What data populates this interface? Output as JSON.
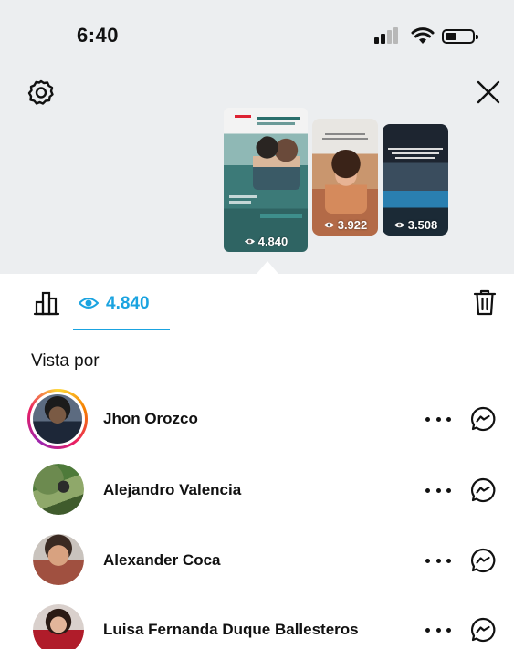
{
  "status_bar": {
    "time": "6:40"
  },
  "stories": [
    {
      "views": "4.840",
      "selected": true
    },
    {
      "views": "3.922",
      "selected": false
    },
    {
      "views": "3.508",
      "selected": false
    }
  ],
  "toolbar": {
    "views_count": "4.840",
    "accent_color": "#1aa3e0"
  },
  "section": {
    "title": "Vista por"
  },
  "viewers": [
    {
      "name": "Jhon Orozco",
      "has_story_ring": true
    },
    {
      "name": "Alejandro Valencia",
      "has_story_ring": false
    },
    {
      "name": "Alexander Coca",
      "has_story_ring": false
    },
    {
      "name": "Luisa Fernanda Duque Ballesteros",
      "has_story_ring": false
    }
  ],
  "icons": [
    "settings-icon",
    "close-icon",
    "chart-icon",
    "eye-icon",
    "trash-icon",
    "more-icon",
    "messenger-icon"
  ]
}
